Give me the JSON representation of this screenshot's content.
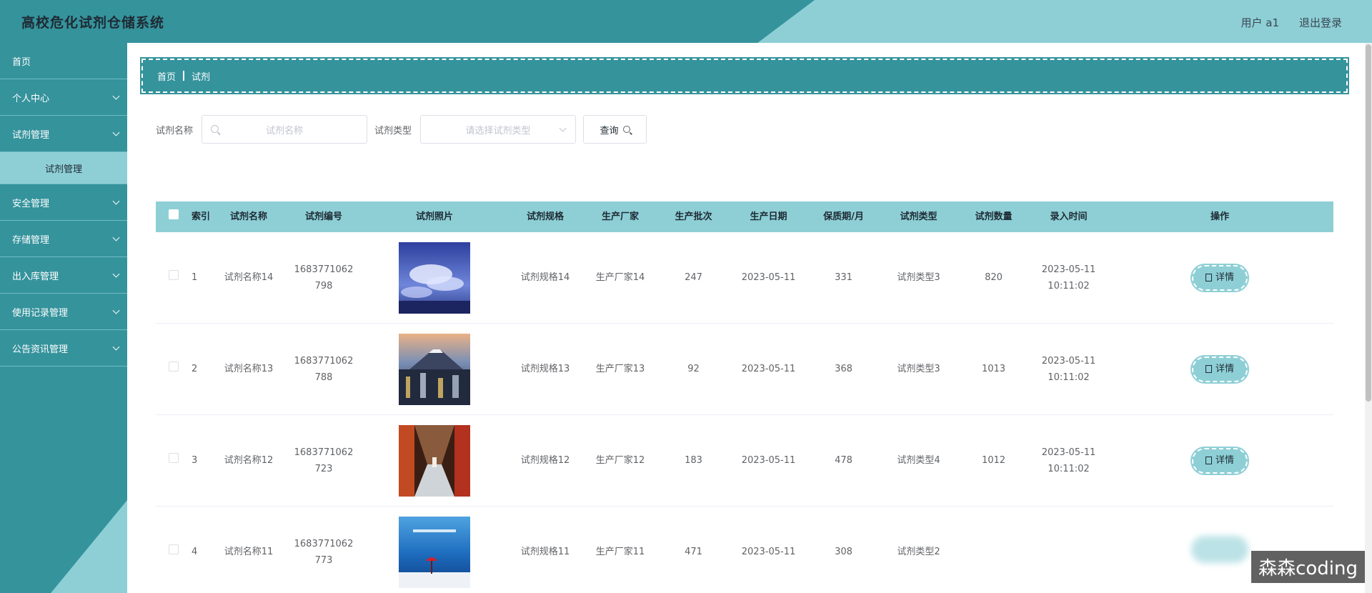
{
  "header": {
    "title": "高校危化试剂仓储系统",
    "user": "用户 a1",
    "logout": "退出登录"
  },
  "sidebar": {
    "items": [
      {
        "label": "首页",
        "expandable": false
      },
      {
        "label": "个人中心",
        "expandable": true
      },
      {
        "label": "试剂管理",
        "expandable": true,
        "expanded": true,
        "children": [
          "试剂管理"
        ]
      },
      {
        "label": "安全管理",
        "expandable": true
      },
      {
        "label": "存储管理",
        "expandable": true
      },
      {
        "label": "出入库管理",
        "expandable": true
      },
      {
        "label": "使用记录管理",
        "expandable": true
      },
      {
        "label": "公告资讯管理",
        "expandable": true
      }
    ]
  },
  "breadcrumb": {
    "home": "首页",
    "current": "试剂"
  },
  "search": {
    "name_label": "试剂名称",
    "name_placeholder": "试剂名称",
    "type_label": "试剂类型",
    "type_placeholder": "请选择试剂类型",
    "query_button": "查询"
  },
  "table": {
    "columns": [
      "索引",
      "试剂名称",
      "试剂编号",
      "试剂照片",
      "试剂规格",
      "生产厂家",
      "生产批次",
      "生产日期",
      "保质期/月",
      "试剂类型",
      "试剂数量",
      "录入时间",
      "操作"
    ],
    "detail_label": "详情",
    "rows": [
      {
        "index": "1",
        "name": "试剂名称14",
        "code_a": "1683771062",
        "code_b": "798",
        "photo": "sky-clouds",
        "spec": "试剂规格14",
        "maker": "生产厂家14",
        "batch": "247",
        "date": "2023-05-11",
        "shelf": "331",
        "type": "试剂类型3",
        "qty": "820",
        "time_a": "2023-05-11",
        "time_b": "10:11:02"
      },
      {
        "index": "2",
        "name": "试剂名称13",
        "code_a": "1683771062",
        "code_b": "788",
        "photo": "mountain-city-night",
        "spec": "试剂规格13",
        "maker": "生产厂家13",
        "batch": "92",
        "date": "2023-05-11",
        "shelf": "368",
        "type": "试剂类型3",
        "qty": "1013",
        "time_a": "2023-05-11",
        "time_b": "10:11:02"
      },
      {
        "index": "3",
        "name": "试剂名称12",
        "code_a": "1683771062",
        "code_b": "723",
        "photo": "corridor",
        "spec": "试剂规格12",
        "maker": "生产厂家12",
        "batch": "183",
        "date": "2023-05-11",
        "shelf": "478",
        "type": "试剂类型4",
        "qty": "1012",
        "time_a": "2023-05-11",
        "time_b": "10:11:02"
      },
      {
        "index": "4",
        "name": "试剂名称11",
        "code_a": "1683771062",
        "code_b": "773",
        "photo": "sea-umbrella",
        "spec": "试剂规格11",
        "maker": "生产厂家11",
        "batch": "471",
        "date": "2023-05-11",
        "shelf": "308",
        "type": "试剂类型2",
        "qty": "",
        "time_a": "",
        "time_b": ""
      }
    ]
  },
  "watermark": "森森coding",
  "colors": {
    "primary": "#35939c",
    "light": "#8ecfd6"
  }
}
